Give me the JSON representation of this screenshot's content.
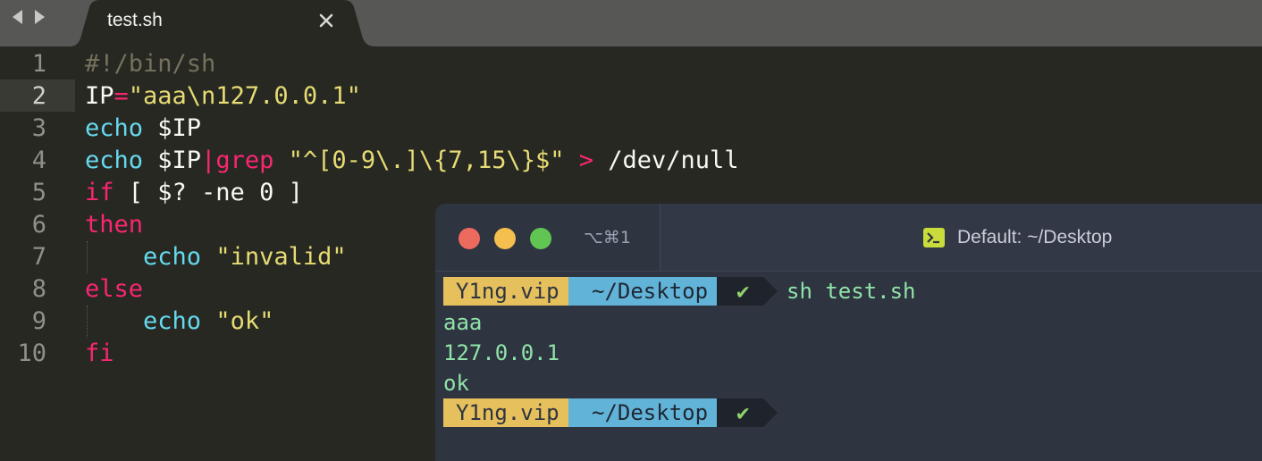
{
  "editor": {
    "tab": {
      "title": "test.sh",
      "close_glyph": "✕"
    },
    "active_line": 2,
    "line_numbers": [
      "1",
      "2",
      "3",
      "4",
      "5",
      "6",
      "7",
      "8",
      "9",
      "10"
    ],
    "code_lines": [
      [
        {
          "t": "#!/bin/sh",
          "c": "comment"
        }
      ],
      [
        {
          "t": "IP",
          "c": "plain"
        },
        {
          "t": "=",
          "c": "op"
        },
        {
          "t": "\"aaa\\n127.0.0.1\"",
          "c": "str"
        }
      ],
      [
        {
          "t": "echo",
          "c": "builtin"
        },
        {
          "t": " $IP",
          "c": "plain"
        }
      ],
      [
        {
          "t": "echo",
          "c": "builtin"
        },
        {
          "t": " $IP",
          "c": "plain"
        },
        {
          "t": "|",
          "c": "op"
        },
        {
          "t": "grep",
          "c": "kw"
        },
        {
          "t": " ",
          "c": "plain"
        },
        {
          "t": "\"^[0-9\\.]\\{7,15\\}$\"",
          "c": "str"
        },
        {
          "t": " ",
          "c": "plain"
        },
        {
          "t": ">",
          "c": "op"
        },
        {
          "t": " /dev/null",
          "c": "plain"
        }
      ],
      [
        {
          "t": "if",
          "c": "kw"
        },
        {
          "t": " [ $? -ne 0 ]",
          "c": "plain"
        }
      ],
      [
        {
          "t": "then",
          "c": "kw"
        }
      ],
      [
        {
          "t": "    ",
          "c": "plain"
        },
        {
          "t": "echo",
          "c": "builtin"
        },
        {
          "t": " ",
          "c": "plain"
        },
        {
          "t": "\"invalid\"",
          "c": "str"
        }
      ],
      [
        {
          "t": "else",
          "c": "kw"
        }
      ],
      [
        {
          "t": "    ",
          "c": "plain"
        },
        {
          "t": "echo",
          "c": "builtin"
        },
        {
          "t": " ",
          "c": "plain"
        },
        {
          "t": "\"ok\"",
          "c": "str"
        }
      ],
      [
        {
          "t": "fi",
          "c": "kw"
        }
      ]
    ]
  },
  "terminal": {
    "shortcut": "⌥⌘1",
    "title": "Default: ~/Desktop",
    "prompt": {
      "user": "Y1ng.vip",
      "dir": "~/Desktop",
      "status": "✔"
    },
    "command": "sh test.sh",
    "output": [
      "aaa",
      "127.0.0.1",
      "ok"
    ]
  },
  "colors": {
    "editor_bg": "#272822",
    "tabbar_bg": "#575755",
    "terminal_bg": "#2e3440",
    "prompt_user_bg": "#e5c05c",
    "prompt_dir_bg": "#62b3d8",
    "prompt_status_bg": "#1f232b",
    "output_text": "#8fe3a8"
  }
}
